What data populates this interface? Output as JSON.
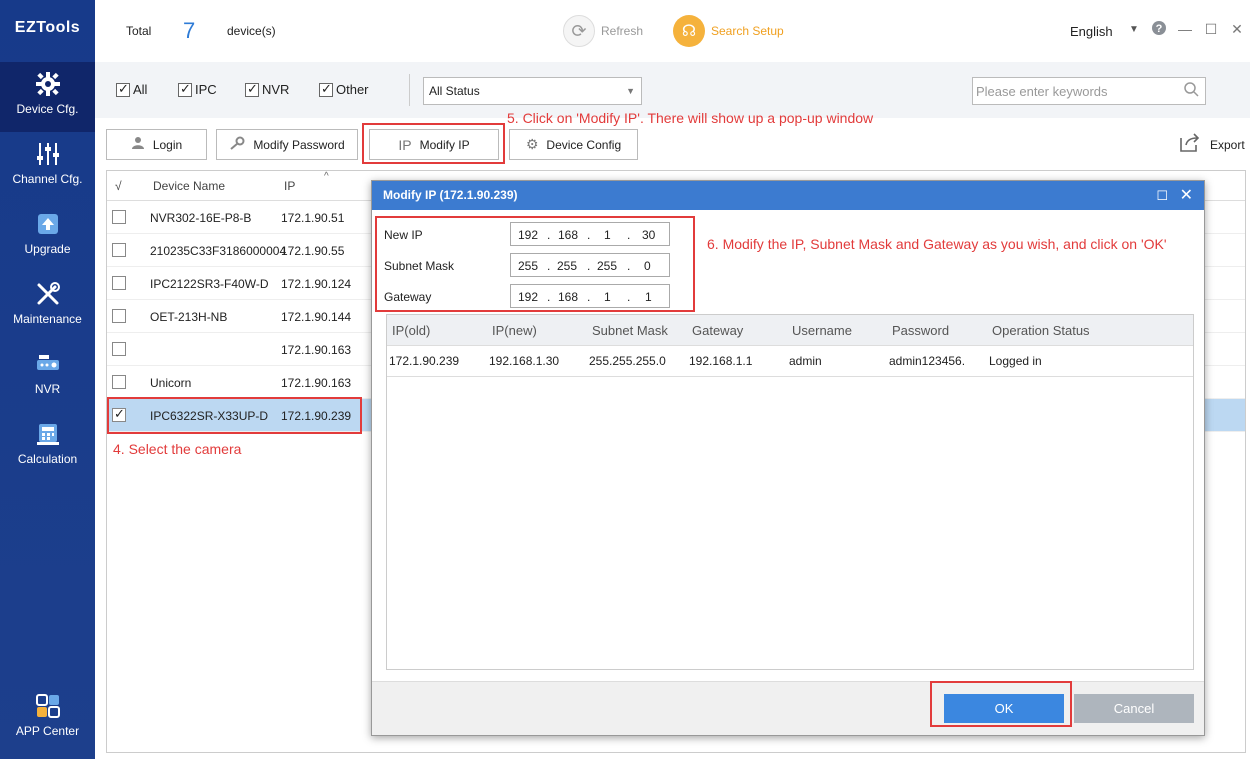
{
  "app": {
    "logo": "EZTools"
  },
  "sidebar": {
    "items": [
      {
        "label": "Device Cfg.",
        "icon": "gear-icon",
        "active": true
      },
      {
        "label": "Channel Cfg.",
        "icon": "sliders-icon"
      },
      {
        "label": "Upgrade",
        "icon": "upgrade-icon"
      },
      {
        "label": "Maintenance",
        "icon": "wrench-icon"
      },
      {
        "label": "NVR",
        "icon": "nvr-icon"
      },
      {
        "label": "Calculation",
        "icon": "calculator-icon"
      },
      {
        "label": "APP Center",
        "icon": "app-grid-icon"
      }
    ]
  },
  "topbar": {
    "total_label": "Total",
    "total_count": "7",
    "total_unit": "device(s)",
    "refresh_label": "Refresh",
    "search_setup_label": "Search Setup",
    "language": "English",
    "accent_color": "#f0a020"
  },
  "filters": {
    "checkboxes": [
      {
        "label": "All",
        "checked": true
      },
      {
        "label": "IPC",
        "checked": true
      },
      {
        "label": "NVR",
        "checked": true
      },
      {
        "label": "Other",
        "checked": true
      }
    ],
    "status_select": "All Status",
    "search_placeholder": "Please enter keywords"
  },
  "toolbar": {
    "login": "Login",
    "modify_password": "Modify Password",
    "modify_ip": "Modify IP",
    "device_config": "Device Config",
    "export": "Export"
  },
  "annotations": {
    "step4": "4. Select the camera",
    "step5": "5. Click on 'Modify IP'. There will show up a pop-up window",
    "step6": "6. Modify the IP, Subnet Mask and Gateway as you wish, and click on 'OK'",
    "color": "#e23b3b"
  },
  "table": {
    "columns": {
      "check": "√",
      "name": "Device Name",
      "ip": "IP"
    },
    "rows": [
      {
        "name": "NVR302-16E-P8-B",
        "ip": "172.1.90.51",
        "checked": false
      },
      {
        "name": "210235C33F3186000004",
        "ip": "172.1.90.55",
        "checked": false
      },
      {
        "name": "IPC2122SR3-F40W-D",
        "ip": "172.1.90.124",
        "checked": false
      },
      {
        "name": "OET-213H-NB",
        "ip": "172.1.90.144",
        "checked": false
      },
      {
        "name": "",
        "ip": "172.1.90.163",
        "checked": false
      },
      {
        "name": "Unicorn",
        "ip": "172.1.90.163",
        "checked": false
      },
      {
        "name": "IPC6322SR-X33UP-D",
        "ip": "172.1.90.239",
        "checked": true
      }
    ]
  },
  "modal": {
    "title": "Modify IP (172.1.90.239)",
    "new_ip_label": "New IP",
    "new_ip": [
      "192",
      "168",
      "1",
      "30"
    ],
    "subnet_label": "Subnet Mask",
    "subnet": [
      "255",
      "255",
      "255",
      "0"
    ],
    "gateway_label": "Gateway",
    "gateway": [
      "192",
      "168",
      "1",
      "1"
    ],
    "dot": ".",
    "grid": {
      "headers": [
        "IP(old)",
        "IP(new)",
        "Subnet Mask",
        "Gateway",
        "Username",
        "Password",
        "Operation Status"
      ],
      "row": [
        "172.1.90.239",
        "192.168.1.30",
        "255.255.255.0",
        "192.168.1.1",
        "admin",
        "admin123456.",
        "Logged in"
      ]
    },
    "ok": "OK",
    "cancel": "Cancel"
  }
}
